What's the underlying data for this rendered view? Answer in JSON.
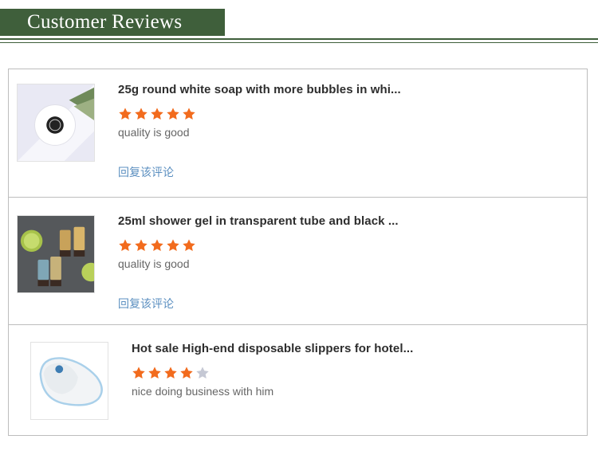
{
  "header": {
    "title": "Customer Reviews"
  },
  "colors": {
    "brand_green": "#3f5f3b",
    "star_active": "#f26b1d",
    "star_inactive": "#c5c8d4",
    "reply_link": "#5b8fc0"
  },
  "reviews": [
    {
      "product_title": "25g round white soap with more bubbles in whi...",
      "rating": 5,
      "max_rating": 5,
      "comment": "quality is good",
      "reply_label": "回复该评论",
      "thumbnail": "soap-product-image"
    },
    {
      "product_title": "25ml shower gel in transparent tube and black ...",
      "rating": 5,
      "max_rating": 5,
      "comment": "quality is good",
      "reply_label": "回复该评论",
      "thumbnail": "shower-gel-product-image"
    },
    {
      "product_title": "Hot sale High-end disposable slippers for hotel...",
      "rating": 4,
      "max_rating": 5,
      "comment": "nice doing business with him",
      "thumbnail": "slippers-product-image"
    }
  ]
}
